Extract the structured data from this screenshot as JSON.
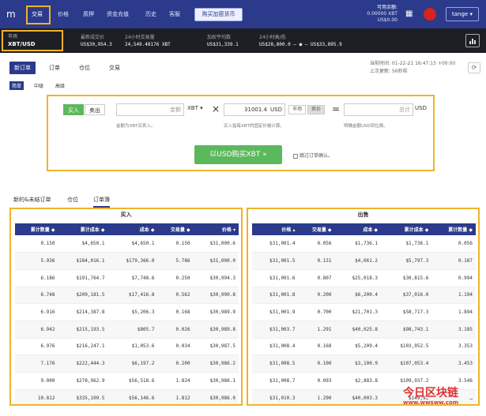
{
  "nav": {
    "items": [
      "交易",
      "价格",
      "质押",
      "资金充值",
      "历史",
      "客服"
    ],
    "buy_crypto": "购买加密货币",
    "balance_title": "可用余额:",
    "balance_xbt": "0.00000 XBT",
    "balance_usd": "US$0.00",
    "user": "tange ▾"
  },
  "market": {
    "label": "市场",
    "symbol": "XBT/USD",
    "stats": [
      {
        "k": "最新成交价",
        "v": "US$30,954.3"
      },
      {
        "k": "24小时交易量",
        "v": "24,549.48176 XBT"
      },
      {
        "k": "加权平均数",
        "v": "US$31,339.1"
      },
      {
        "k": "24小时高/低",
        "v": "US$28,800.0 — ● — US$33,895.9"
      }
    ]
  },
  "order_tabs": [
    "新订单",
    "订单",
    "仓位",
    "交易"
  ],
  "right_info": {
    "time": "当前时间:  01-22-21 16:47:15 +00:00",
    "updated": "上次更新:  56秒前"
  },
  "order_modes": [
    "简单",
    "中级",
    "高级"
  ],
  "order_form": {
    "buy": "买入",
    "sell": "卖出",
    "amount_placeholder": "金额",
    "amount_unit": "XBT ▾",
    "times": "×",
    "price_value": "31001.4",
    "price_unit": "USD",
    "market_btn": "市场",
    "ask_btn": "卖价",
    "equals": "=",
    "total_placeholder": "总计",
    "total_unit": "USD",
    "hint_amount": "金额为XBT买卖入。",
    "hint_price": "买入指每XBT的固定价格计算。",
    "hint_total": "明确金额USD到位费。",
    "submit": "以USD购买XBT »",
    "skip_confirm": "跳过订单确认。"
  },
  "book_tabs": [
    "新的&未结订单",
    "仓位",
    "订单簿"
  ],
  "buy_book": {
    "title": "买入",
    "headers": [
      "累计数量 ◆",
      "累计成本 ◆",
      "成本 ◆",
      "交易量 ◆",
      "价格 ▾"
    ],
    "rows": [
      [
        "0.150",
        "$4,650.1",
        "$4,650.1",
        "0.150",
        "$31,000.6"
      ],
      [
        "5.936",
        "$184,016.1",
        "$179,366.0",
        "5.786",
        "$31,000.0"
      ],
      [
        "6.186",
        "$191,764.7",
        "$7,748.6",
        "0.250",
        "$30,994.3"
      ],
      [
        "6.748",
        "$209,181.5",
        "$17,416.8",
        "0.562",
        "$30,990.8"
      ],
      [
        "6.916",
        "$214,387.8",
        "$5,206.3",
        "0.168",
        "$30,989.9"
      ],
      [
        "6.942",
        "$215,193.5",
        "$805.7",
        "0.026",
        "$30,989.8"
      ],
      [
        "6.976",
        "$216,247.1",
        "$1,053.6",
        "0.034",
        "$30,987.5"
      ],
      [
        "7.176",
        "$222,444.3",
        "$6,197.2",
        "0.200",
        "$30,986.2"
      ],
      [
        "9.000",
        "$278,962.9",
        "$56,518.6",
        "1.824",
        "$30,986.1"
      ],
      [
        "10.812",
        "$335,109.5",
        "$56,146.6",
        "1.812",
        "$30,986.0"
      ]
    ]
  },
  "sell_book": {
    "title": "出售",
    "headers": [
      "价格 ▴",
      "交易量 ◆",
      "成本 ◆",
      "累计成本 ◆",
      "累计数量 ◆"
    ],
    "rows": [
      [
        "$31,001.4",
        "0.056",
        "$1,736.1",
        "$1,736.1",
        "0.056"
      ],
      [
        "$31,001.5",
        "0.131",
        "$4,061.2",
        "$5,797.3",
        "0.187"
      ],
      [
        "$31,001.6",
        "0.807",
        "$25,018.3",
        "$30,815.6",
        "0.994"
      ],
      [
        "$31,001.8",
        "0.200",
        "$6,200.4",
        "$37,016.0",
        "1.194"
      ],
      [
        "$31,001.9",
        "0.700",
        "$21,701.3",
        "$58,717.3",
        "1.894"
      ],
      [
        "$31,003.7",
        "1.291",
        "$40,025.8",
        "$98,743.1",
        "3.185"
      ],
      [
        "$31,008.4",
        "0.168",
        "$5,209.4",
        "$103,952.5",
        "3.353"
      ],
      [
        "$31,008.5",
        "0.100",
        "$3,100.9",
        "$107,053.4",
        "3.453"
      ],
      [
        "$31,008.7",
        "0.093",
        "$2,883.8",
        "$109,937.2",
        "3.546"
      ],
      [
        "$31,010.3",
        "1.290",
        "$40,003.3",
        "$149,9…",
        "…"
      ]
    ]
  },
  "watermark": {
    "text": "今日区块链",
    "url": "www.wwsww.com"
  },
  "colors": {
    "nav_bg": "#2b3a8a",
    "market_bg": "#1e1f25",
    "highlight": "#f0b429",
    "buy_green": "#5cb85c"
  }
}
